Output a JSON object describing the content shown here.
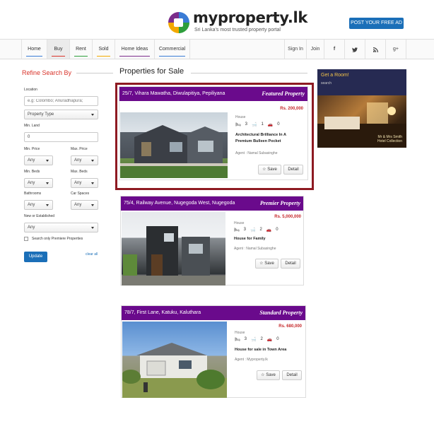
{
  "header": {
    "logo_name": "myproperty.lk",
    "tagline": "Sri Lanka's most trusted property portal",
    "post_ad": "POST YOUR FREE AD"
  },
  "nav": {
    "items": [
      "Home",
      "Buy",
      "Rent",
      "Sold",
      "Home Ideas",
      "Commercial"
    ],
    "active": "Buy",
    "underline_colors": [
      "#3a7bd5",
      "#d9342b",
      "#2e9e3c",
      "#f2a900",
      "#7b2d8b",
      "#3a7bd5"
    ],
    "sign_in": "Sign In",
    "join": "Join",
    "social": [
      "f",
      "t",
      "rss",
      "g+"
    ]
  },
  "sidebar": {
    "title": "Refine Search By",
    "location_label": "Location",
    "location_placeholder": "e.g: Colombo; Anuradhapura;",
    "property_type": "Property Type",
    "min_land_label": "Min. Land",
    "min_land_value": "0",
    "min_price_label": "Min. Price",
    "max_price_label": "Max. Price",
    "min_price": "Any",
    "max_price": "Any",
    "min_beds_label": "Min. Beds",
    "max_beds_label": "Max. Beds",
    "min_beds": "Any",
    "max_beds": "Any",
    "bathrooms_label": "Bathrooms",
    "car_spaces_label": "Car Spaces",
    "bathrooms": "Any",
    "car_spaces": "Any",
    "new_established_label": "New or Established",
    "new_established": "Any",
    "premiere_only": "Search only Premiere Properties",
    "update": "Update",
    "clear_all": "clear all"
  },
  "main": {
    "title": "Properties for Sale",
    "listings": [
      {
        "address": "25/7, Vihara Mawatha, Diwulapitiya, Pepiliyana",
        "tag": "Featured Property",
        "price": "Rs. 200,000",
        "type": "House",
        "beds": "3",
        "baths": "1",
        "cars": "0",
        "description": "Architectural Brilliance In A Premium Bulleen Pocket",
        "agent": "Agent : Namal Subasinghe",
        "save": "Save",
        "detail": "Detail"
      },
      {
        "address": "75/4, Railway Avenue, Nugegoda West, Nugegoda",
        "tag": "Premier Property",
        "price": "Rs. 5,000,000",
        "type": "House",
        "beds": "3",
        "baths": "2",
        "cars": "0",
        "description": "House for Family",
        "agent": "Agent : Namal Subasinghe",
        "save": "Save",
        "detail": "Detail"
      },
      {
        "address": "78/7, First Lane, Katuku, Kaluthara",
        "tag": "Standard Property",
        "price": "Rs. 680,000",
        "type": "House",
        "beds": "3",
        "baths": "2",
        "cars": "0",
        "description": "House for sale in Town Area",
        "agent": "Agent : Myproperty.lk",
        "save": "Save",
        "detail": "Detail"
      }
    ]
  },
  "ad": {
    "title": "Get a Room!",
    "sub": "search",
    "brand": "Mr & Mrs Smith",
    "brand_sub": "Hotel Collection"
  }
}
